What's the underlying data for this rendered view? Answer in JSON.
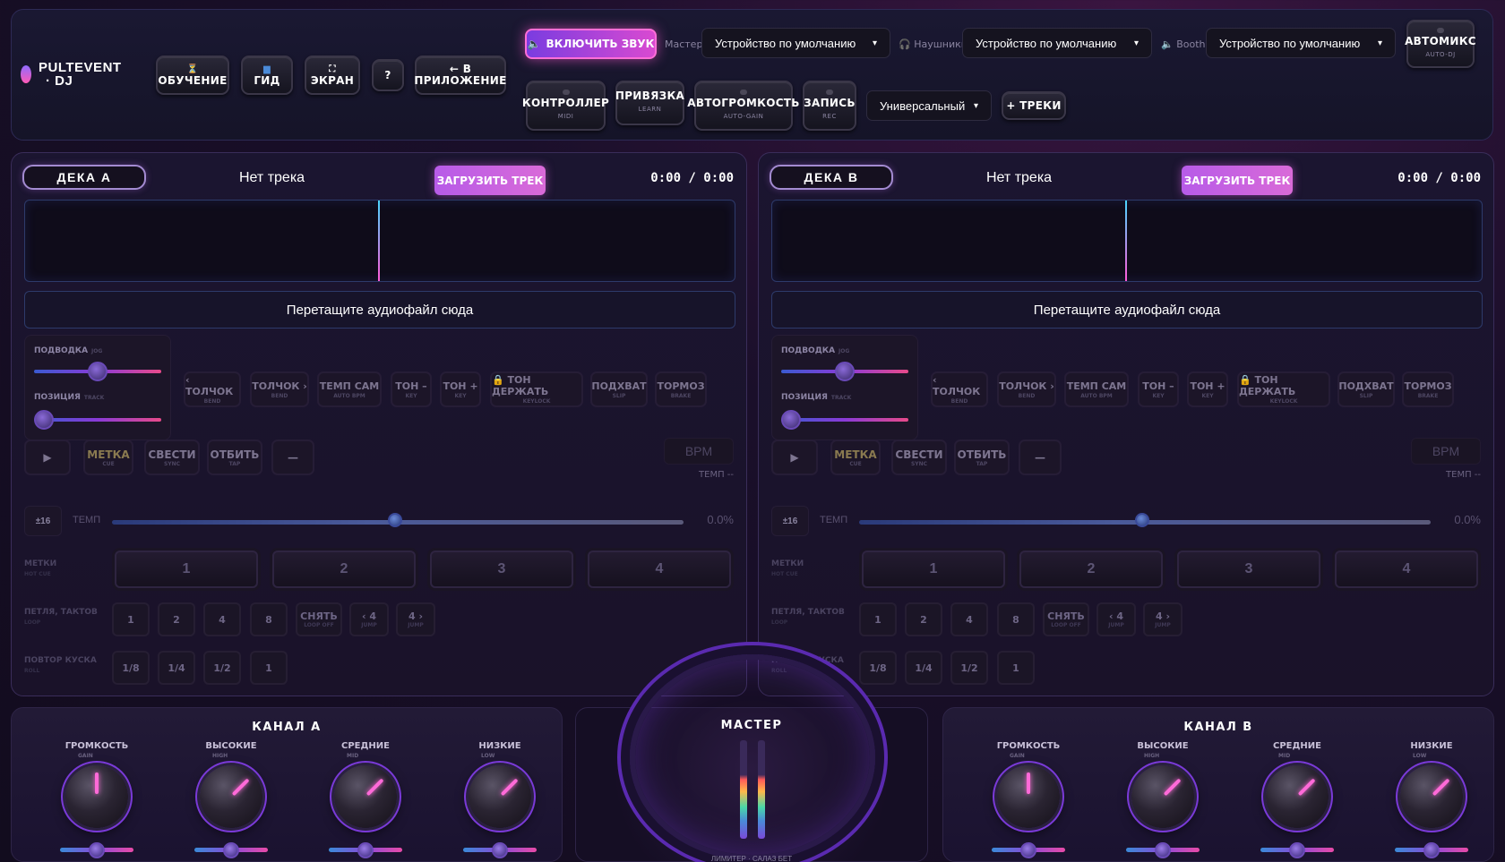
{
  "app": {
    "logo_line1": "PULTEVENT",
    "logo_line2": "· DJ"
  },
  "top": {
    "buttons": [
      {
        "label": "ОБУЧЕНИЕ",
        "icon": "hourglass-icon"
      },
      {
        "label": "ГИД",
        "icon": "book-icon"
      },
      {
        "label": "ЭКРАН",
        "icon": "fullscreen-icon"
      },
      {
        "label": "?"
      },
      {
        "label": "← В ПРИЛОЖЕНИЕ"
      }
    ],
    "sound_button": "ВКЛЮЧИТЬ ЗВУК",
    "master_label": "Мастер",
    "master_device": "Устройство по умолчанию",
    "headphones_label": "Наушники",
    "headphones_device": "Устройство по умолчанию",
    "booth_label": "Booth",
    "booth_device": "Устройство по умолчанию",
    "automix": {
      "label": "АВТОМИКС",
      "sub": "AUTO-DJ"
    },
    "row2": [
      {
        "label": "КОНТРОЛЛЕР",
        "sub": "MIDI"
      },
      {
        "label": "ПРИВЯЗКА",
        "sub": "LEARN"
      },
      {
        "label": "АВТОГРОМКОСТЬ",
        "sub": "AUTO-GAIN"
      },
      {
        "label": "ЗАПИСЬ",
        "sub": "REC"
      }
    ],
    "mapping_select": "Универсальный",
    "tracks_button": "+ ТРЕКИ"
  },
  "decks": [
    {
      "name": "ДЕКА A",
      "track": "Нет трека",
      "load": "ЗАГРУЗИТЬ ТРЕК",
      "time": "0:00 / 0:00",
      "drop": "Перетащите аудиофайл сюда",
      "jog_label": "ПОДВОДКА",
      "jog_sub": "JOG",
      "pos_label": "ПОЗИЦИЯ",
      "pos_sub": "TRACK",
      "bpm": "BPM",
      "tempo_label": "ТЕМП --",
      "range": "±16",
      "tempo_txt": "ТЕМП",
      "tempo_val": "0.0%",
      "tempo_value_pct": 0
    },
    {
      "name": "ДЕКА B",
      "track": "Нет трека",
      "load": "ЗАГРУЗИТЬ ТРЕК",
      "time": "0:00 / 0:00",
      "drop": "Перетащите аудиофайл сюда",
      "jog_label": "ПОДВОДКА",
      "jog_sub": "JOG",
      "pos_label": "ПОЗИЦИЯ",
      "pos_sub": "TRACK",
      "bpm": "BPM",
      "tempo_label": "ТЕМП --",
      "range": "±16",
      "tempo_txt": "ТЕМП",
      "tempo_val": "0.0%",
      "tempo_value_pct": 0
    }
  ],
  "fx": [
    {
      "label": "‹ ТОЛЧОК",
      "sub": "BEND"
    },
    {
      "label": "ТОЛЧОК ›",
      "sub": "BEND"
    },
    {
      "label": "ТЕМП САМ",
      "sub": "AUTO BPM"
    },
    {
      "label": "ТОН –",
      "sub": "KEY"
    },
    {
      "label": "ТОН +",
      "sub": "KEY"
    },
    {
      "label": "🔒 ТОН ДЕРЖАТЬ",
      "sub": "KEYLOCK"
    },
    {
      "label": "ПОДХВАТ",
      "sub": "SLIP"
    },
    {
      "label": "ТОРМОЗ",
      "sub": "BRAKE"
    }
  ],
  "transport": [
    {
      "label": "▶",
      "sub": ""
    },
    {
      "label": "МЕТКА",
      "sub": "CUE"
    },
    {
      "label": "СВЕСТИ",
      "sub": "SYNC"
    },
    {
      "label": "ОТБИТЬ",
      "sub": "TAP"
    },
    {
      "label": "—",
      "sub": ""
    }
  ],
  "hotcues": {
    "label": "МЕТКИ",
    "sub": "HOT CUE",
    "items": [
      "1",
      "2",
      "3",
      "4"
    ]
  },
  "loops": {
    "label": "ПЕТЛЯ, ТАКТОВ",
    "sub": "LOOP",
    "items": [
      {
        "label": "1",
        "sub": ""
      },
      {
        "label": "2",
        "sub": ""
      },
      {
        "label": "4",
        "sub": ""
      },
      {
        "label": "8",
        "sub": ""
      },
      {
        "label": "СНЯТЬ",
        "sub": "LOOP OFF"
      },
      {
        "label": "‹ 4",
        "sub": "JUMP"
      },
      {
        "label": "4 ›",
        "sub": "JUMP"
      }
    ]
  },
  "rolls": {
    "label": "ПОВТОР КУСКА",
    "sub": "ROLL",
    "items": [
      "1/8",
      "1/4",
      "1/2",
      "1"
    ]
  },
  "mixer": {
    "channels": [
      {
        "title": "КАНАЛ A",
        "knobs": [
          {
            "label": "ГРОМКОСТЬ",
            "sub": "GAIN"
          },
          {
            "label": "ВЫСОКИЕ",
            "sub": "HIGH"
          },
          {
            "label": "СРЕДНИЕ",
            "sub": "MID"
          },
          {
            "label": "НИЗКИЕ",
            "sub": "LOW"
          }
        ]
      },
      {
        "title": "КАНАЛ B",
        "knobs": [
          {
            "label": "ГРОМКОСТЬ",
            "sub": "GAIN"
          },
          {
            "label": "ВЫСОКИЕ",
            "sub": "HIGH"
          },
          {
            "label": "СРЕДНИЕ",
            "sub": "MID"
          },
          {
            "label": "НИЗКИЕ",
            "sub": "LOW"
          }
        ]
      }
    ],
    "master_title": "МАСТЕР",
    "master_bottom": "ЛИМИТЕР · САЛАЗ БЕТ"
  }
}
